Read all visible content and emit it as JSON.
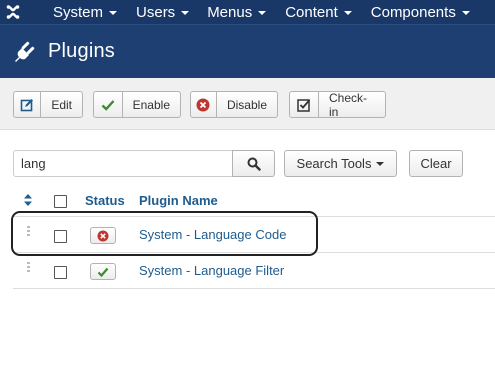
{
  "topnav": {
    "items": [
      {
        "label": "System"
      },
      {
        "label": "Users"
      },
      {
        "label": "Menus"
      },
      {
        "label": "Content"
      },
      {
        "label": "Components"
      }
    ]
  },
  "header": {
    "title": "Plugins"
  },
  "toolbar": {
    "edit_label": "Edit",
    "enable_label": "Enable",
    "disable_label": "Disable",
    "checkin_label": "Check-in"
  },
  "search": {
    "value": "lang",
    "tools_label": "Search Tools",
    "clear_label": "Clear"
  },
  "table": {
    "columns": {
      "status": "Status",
      "name": "Plugin Name"
    },
    "rows": [
      {
        "name": "System - Language Code",
        "status": "disabled"
      },
      {
        "name": "System - Language Filter",
        "status": "enabled"
      }
    ]
  },
  "colors": {
    "topnav_bg": "#1a3867",
    "header_bg": "#1d3f72",
    "link": "#1f5c8e",
    "enabled": "#3c8a2e",
    "disabled": "#bd362f"
  }
}
